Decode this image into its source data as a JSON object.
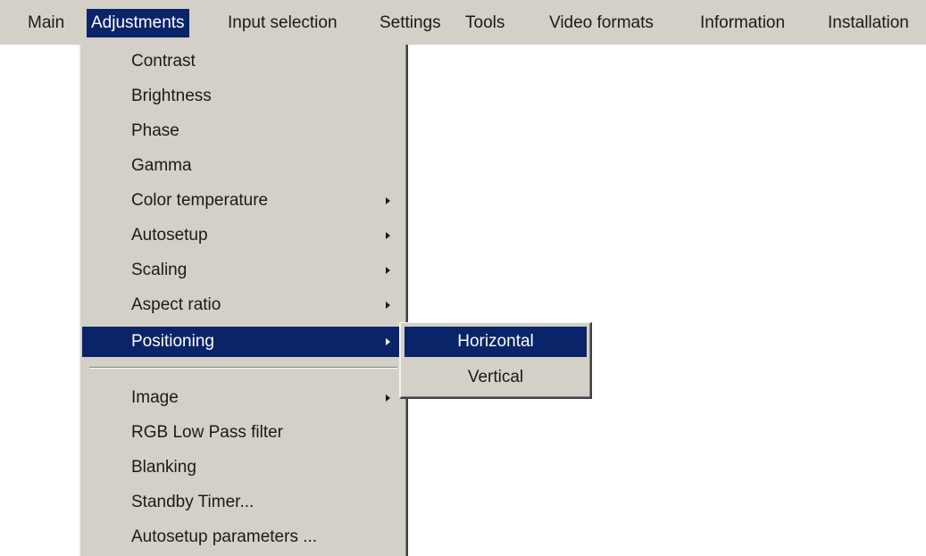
{
  "menubar": {
    "items": [
      {
        "label": "Main"
      },
      {
        "label": "Adjustments"
      },
      {
        "label": "Input selection"
      },
      {
        "label": "Settings"
      },
      {
        "label": "Tools"
      },
      {
        "label": "Video formats"
      },
      {
        "label": "Information"
      },
      {
        "label": "Installation"
      }
    ],
    "active_item": "Adjustments"
  },
  "dropdown": {
    "items": [
      {
        "label": "Contrast",
        "has_submenu": false
      },
      {
        "label": "Brightness",
        "has_submenu": false
      },
      {
        "label": "Phase",
        "has_submenu": false
      },
      {
        "label": "Gamma",
        "has_submenu": false
      },
      {
        "label": "Color temperature",
        "has_submenu": true
      },
      {
        "label": "Autosetup",
        "has_submenu": true
      },
      {
        "label": "Scaling",
        "has_submenu": true
      },
      {
        "label": "Aspect ratio",
        "has_submenu": true
      },
      {
        "label": "Positioning",
        "has_submenu": true
      },
      {
        "label": "Image",
        "has_submenu": true
      },
      {
        "label": "RGB Low Pass filter",
        "has_submenu": false
      },
      {
        "label": "Blanking",
        "has_submenu": false
      },
      {
        "label": "Standby Timer...",
        "has_submenu": false
      },
      {
        "label": "Autosetup parameters ...",
        "has_submenu": false
      }
    ],
    "selected_item": "Positioning"
  },
  "submenu": {
    "items": [
      {
        "label": "Horizontal"
      },
      {
        "label": "Vertical"
      }
    ],
    "selected_item": "Horizontal"
  },
  "colors": {
    "menu_background": "#d4d0c8",
    "highlight": "#0a246a",
    "highlight_text": "#ffffff",
    "text": "#1a1a1a"
  },
  "icons": {
    "submenu_arrow": "chevron-right-icon"
  }
}
